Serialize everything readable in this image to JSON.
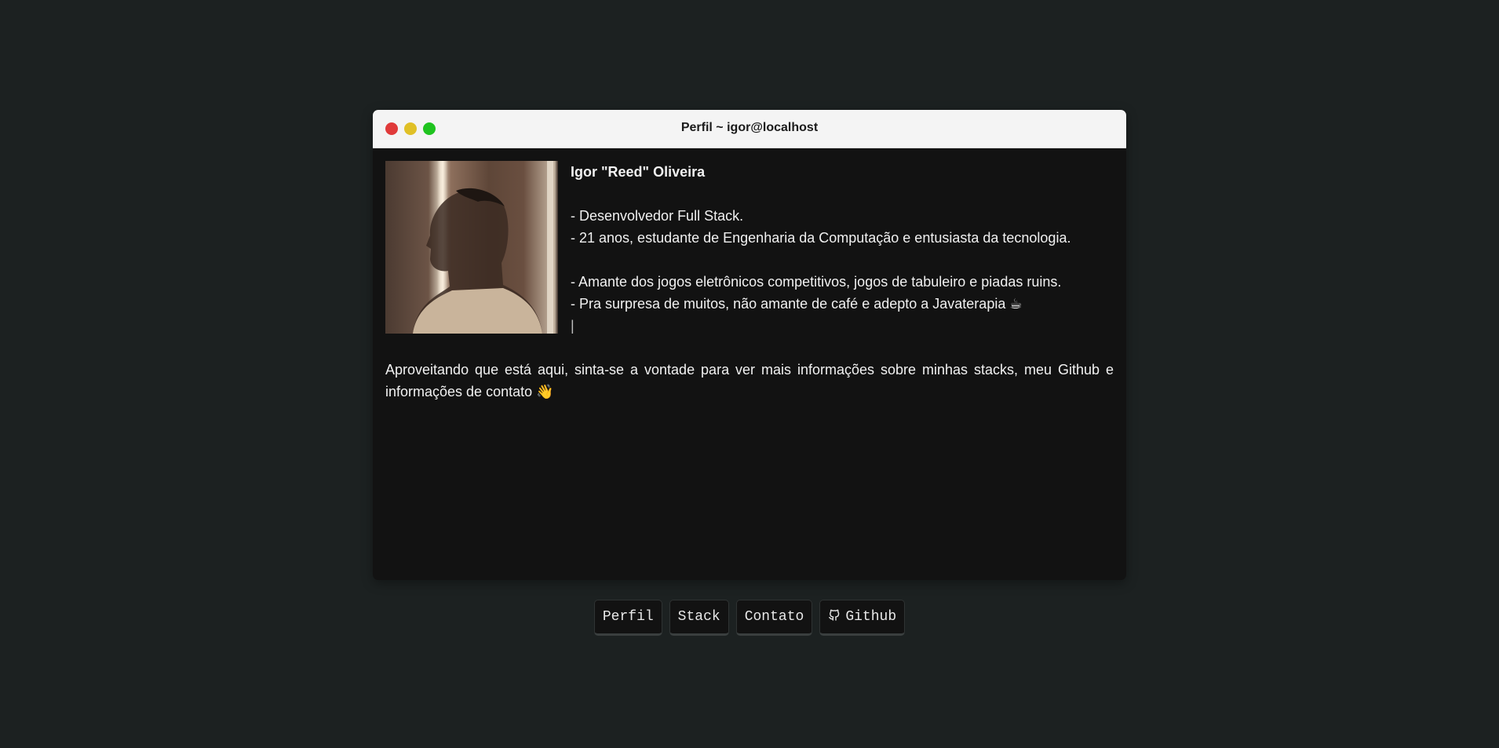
{
  "window": {
    "title": "Perfil ~ igor@localhost"
  },
  "profile": {
    "photo_alt": "profile-photo",
    "name": "Igor \"Reed\" Oliveira",
    "lines_block1": [
      "- Desenvolvedor Full Stack.",
      "- 21 anos, estudante de Engenharia da Computação e entusiasta da tecnologia."
    ],
    "lines_block2": [
      "- Amante dos jogos eletrônicos competitivos, jogos de tabuleiro e piadas ruins.",
      "- Pra surpresa de muitos, não amante de café e adepto a Javaterapia ☕"
    ],
    "cursor": "|",
    "intro": "Aproveitando que está aqui, sinta-se a vontade para ver mais informações sobre minhas stacks, meu Github e informações de contato 👋"
  },
  "nav": {
    "items": [
      {
        "label": "Perfil"
      },
      {
        "label": "Stack"
      },
      {
        "label": "Contato"
      },
      {
        "label": "Github",
        "icon": "github-icon"
      }
    ]
  },
  "colors": {
    "background": "#1c2121",
    "window_bg": "#121212",
    "titlebar_bg": "#f4f4f4",
    "dot_red": "#e03a3a",
    "dot_yellow": "#e0c026",
    "dot_green": "#1fc31f"
  }
}
